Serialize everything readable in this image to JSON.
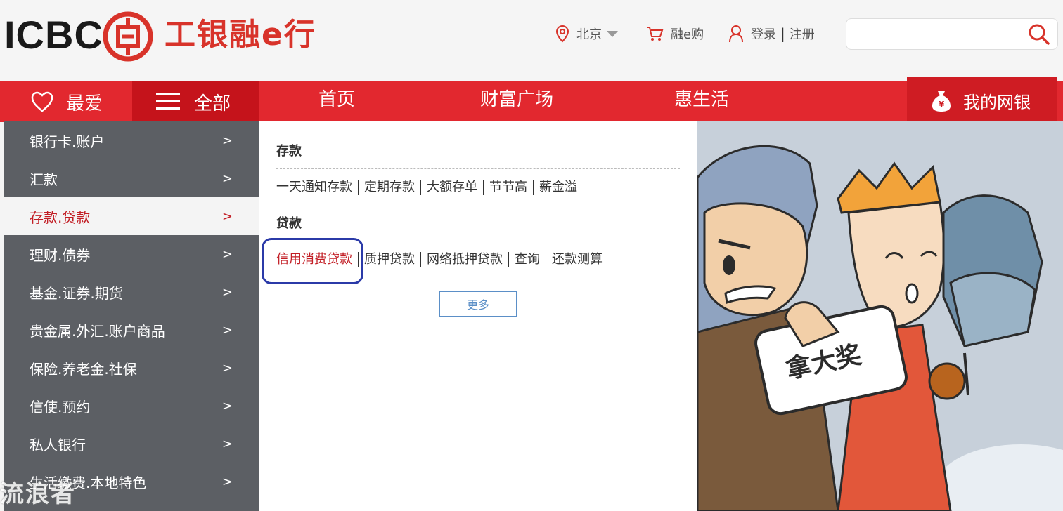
{
  "header": {
    "logo_text": "ICBC",
    "logo_cn": "工银融e行",
    "location": "北京",
    "mall": "融e购",
    "login": "登录",
    "separator": "|",
    "register": "注册",
    "search_placeholder": ""
  },
  "nav": {
    "favorites": "最爱",
    "all": "全部",
    "links": [
      "首页",
      "财富广场",
      "惠生活"
    ],
    "my_bank": "我的网银"
  },
  "sidebar": {
    "items": [
      {
        "label": "银行卡.账户",
        "arrow": ">"
      },
      {
        "label": "汇款",
        "arrow": ">"
      },
      {
        "label": "存款.贷款",
        "arrow": ">"
      },
      {
        "label": "理财.债券",
        "arrow": ">"
      },
      {
        "label": "基金.证券.期货",
        "arrow": ">"
      },
      {
        "label": "贵金属.外汇.账户商品",
        "arrow": ">"
      },
      {
        "label": "保险.养老金.社保",
        "arrow": ">"
      },
      {
        "label": "信使.预约",
        "arrow": ">"
      },
      {
        "label": "私人银行",
        "arrow": ">"
      },
      {
        "label": "生活缴费.本地特色",
        "arrow": ">"
      }
    ]
  },
  "panel": {
    "deposit_title": "存款",
    "deposit_links": [
      "一天通知存款",
      "定期存款",
      "大额存单",
      "节节高",
      "薪金溢"
    ],
    "loan_title": "贷款",
    "loan_links": [
      "信用消费贷款",
      "质押贷款",
      "网络抵押贷款",
      "查询",
      "还款测算"
    ],
    "more": "更多"
  },
  "banner": {
    "sign_text": "拿大奖"
  },
  "watermark": "流浪者",
  "colors": {
    "brand_red": "#e2282f",
    "dark_red": "#c5131b",
    "sidebar_gray": "#5c5f64",
    "highlight_red": "#c21d24",
    "annotation_blue": "#2b3aa8"
  }
}
